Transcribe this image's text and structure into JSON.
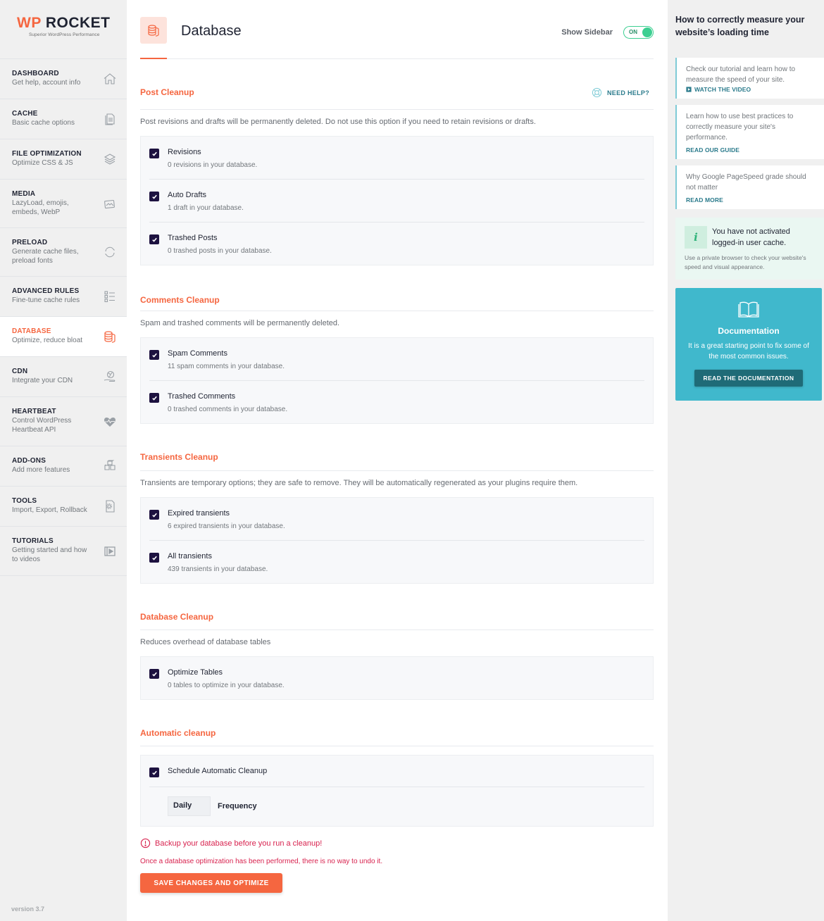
{
  "brand": {
    "logo_prefix": "WP",
    "logo_name": "ROCKET",
    "tagline": "Superior WordPress Performance",
    "accent_color": "#f56640"
  },
  "nav": {
    "items": [
      {
        "title": "DASHBOARD",
        "desc": "Get help, account info",
        "icon": "home-icon",
        "active": false
      },
      {
        "title": "CACHE",
        "desc": "Basic cache options",
        "icon": "file-icon",
        "active": false
      },
      {
        "title": "FILE OPTIMIZATION",
        "desc": "Optimize CSS & JS",
        "icon": "layers-icon",
        "active": false
      },
      {
        "title": "MEDIA",
        "desc": "LazyLoad, emojis, embeds, WebP",
        "icon": "images-icon",
        "active": false
      },
      {
        "title": "PRELOAD",
        "desc": "Generate cache files, preload fonts",
        "icon": "refresh-icon",
        "active": false
      },
      {
        "title": "ADVANCED RULES",
        "desc": "Fine-tune cache rules",
        "icon": "checklist-icon",
        "active": false
      },
      {
        "title": "DATABASE",
        "desc": "Optimize, reduce bloat",
        "icon": "database-icon",
        "active": true
      },
      {
        "title": "CDN",
        "desc": "Integrate your CDN",
        "icon": "globe-hand-icon",
        "active": false
      },
      {
        "title": "HEARTBEAT",
        "desc": "Control WordPress Heartbeat API",
        "icon": "heartbeat-icon",
        "active": false
      },
      {
        "title": "ADD-ONS",
        "desc": "Add more features",
        "icon": "cubes-icon",
        "active": false
      },
      {
        "title": "TOOLS",
        "desc": "Import, Export, Rollback",
        "icon": "gear-file-icon",
        "active": false
      },
      {
        "title": "TUTORIALS",
        "desc": "Getting started and how to videos",
        "icon": "video-icon",
        "active": false
      }
    ],
    "version": "version 3.7"
  },
  "header": {
    "title": "Database",
    "show_sidebar_label": "Show Sidebar",
    "toggle_state": "ON"
  },
  "need_help": "NEED HELP?",
  "sections": {
    "post": {
      "title": "Post Cleanup",
      "desc": "Post revisions and drafts will be permanently deleted. Do not use this option if you need to retain revisions or drafts.",
      "options": [
        {
          "label": "Revisions",
          "desc": "0 revisions in your database.",
          "checked": true
        },
        {
          "label": "Auto Drafts",
          "desc": "1 draft in your database.",
          "checked": true
        },
        {
          "label": "Trashed Posts",
          "desc": "0 trashed posts in your database.",
          "checked": true
        }
      ]
    },
    "comments": {
      "title": "Comments Cleanup",
      "desc": "Spam and trashed comments will be permanently deleted.",
      "options": [
        {
          "label": "Spam Comments",
          "desc": "11 spam comments in your database.",
          "checked": true
        },
        {
          "label": "Trashed Comments",
          "desc": "0 trashed comments in your database.",
          "checked": true
        }
      ]
    },
    "transients": {
      "title": "Transients Cleanup",
      "desc": "Transients are temporary options; they are safe to remove. They will be automatically regenerated as your plugins require them.",
      "options": [
        {
          "label": "Expired transients",
          "desc": "6 expired transients in your database.",
          "checked": true
        },
        {
          "label": "All transients",
          "desc": "439 transients in your database.",
          "checked": true
        }
      ]
    },
    "database": {
      "title": "Database Cleanup",
      "desc": "Reduces overhead of database tables",
      "options": [
        {
          "label": "Optimize Tables",
          "desc": "0 tables to optimize in your database.",
          "checked": true
        }
      ]
    },
    "automatic": {
      "title": "Automatic cleanup",
      "options": [
        {
          "label": "Schedule Automatic Cleanup",
          "checked": true
        }
      ],
      "frequency_value": "Daily",
      "frequency_label": "Frequency"
    }
  },
  "warning": {
    "title": "Backup your database before you run a cleanup!",
    "text": "Once a database optimization has been performed, there is no way to undo it."
  },
  "save_button": "SAVE CHANGES AND OPTIMIZE",
  "right_sidebar": {
    "title": "How to correctly measure your website’s loading time",
    "tips": [
      {
        "text": "Check our tutorial and learn how to measure the speed of your site.",
        "link": "WATCH THE VIDEO"
      },
      {
        "text": "Learn how to use best practices to correctly measure your site's performance.",
        "link": "READ OUR GUIDE"
      },
      {
        "text": "Why Google PageSpeed grade should not matter",
        "link": "READ MORE"
      }
    ],
    "notice": {
      "icon_glyph": "i",
      "title": "You have not activated logged-in user cache.",
      "text": "Use a private browser to check your website's speed and visual appearance."
    },
    "doc": {
      "title": "Documentation",
      "text": "It is a great starting point to fix some of the most common issues.",
      "button": "READ THE DOCUMENTATION"
    }
  }
}
